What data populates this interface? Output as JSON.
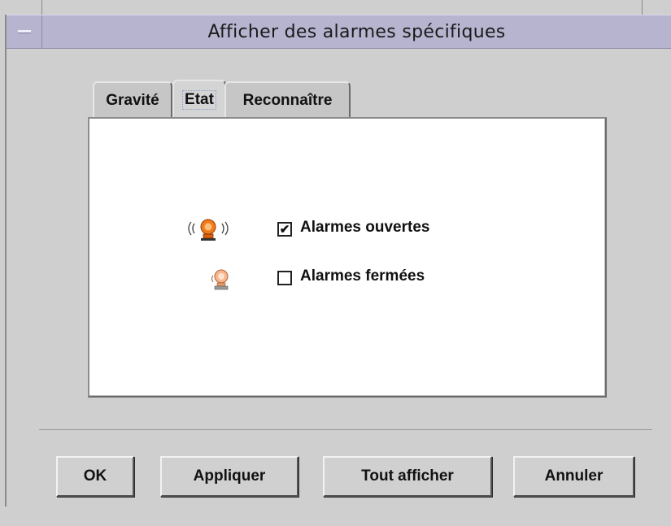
{
  "window": {
    "title": "Afficher des alarmes spécifiques"
  },
  "tabs": [
    {
      "label": "Gravité",
      "active": false
    },
    {
      "label": "Etat",
      "active": true
    },
    {
      "label": "Reconnaître",
      "active": false
    }
  ],
  "options": [
    {
      "label": "Alarmes ouvertes",
      "checked": true,
      "check_glyph": "✔",
      "icon": "ringing-alarm-bell-icon"
    },
    {
      "label": "Alarmes fermées",
      "checked": false,
      "check_glyph": "",
      "icon": "silent-alarm-bell-icon"
    }
  ],
  "buttons": {
    "ok": "OK",
    "apply": "Appliquer",
    "show_all": "Tout afficher",
    "cancel": "Annuler"
  },
  "colors": {
    "titlebar": "#b6b4cf",
    "alarm_orange": "#f07a1c",
    "background": "#cfcfcf"
  }
}
